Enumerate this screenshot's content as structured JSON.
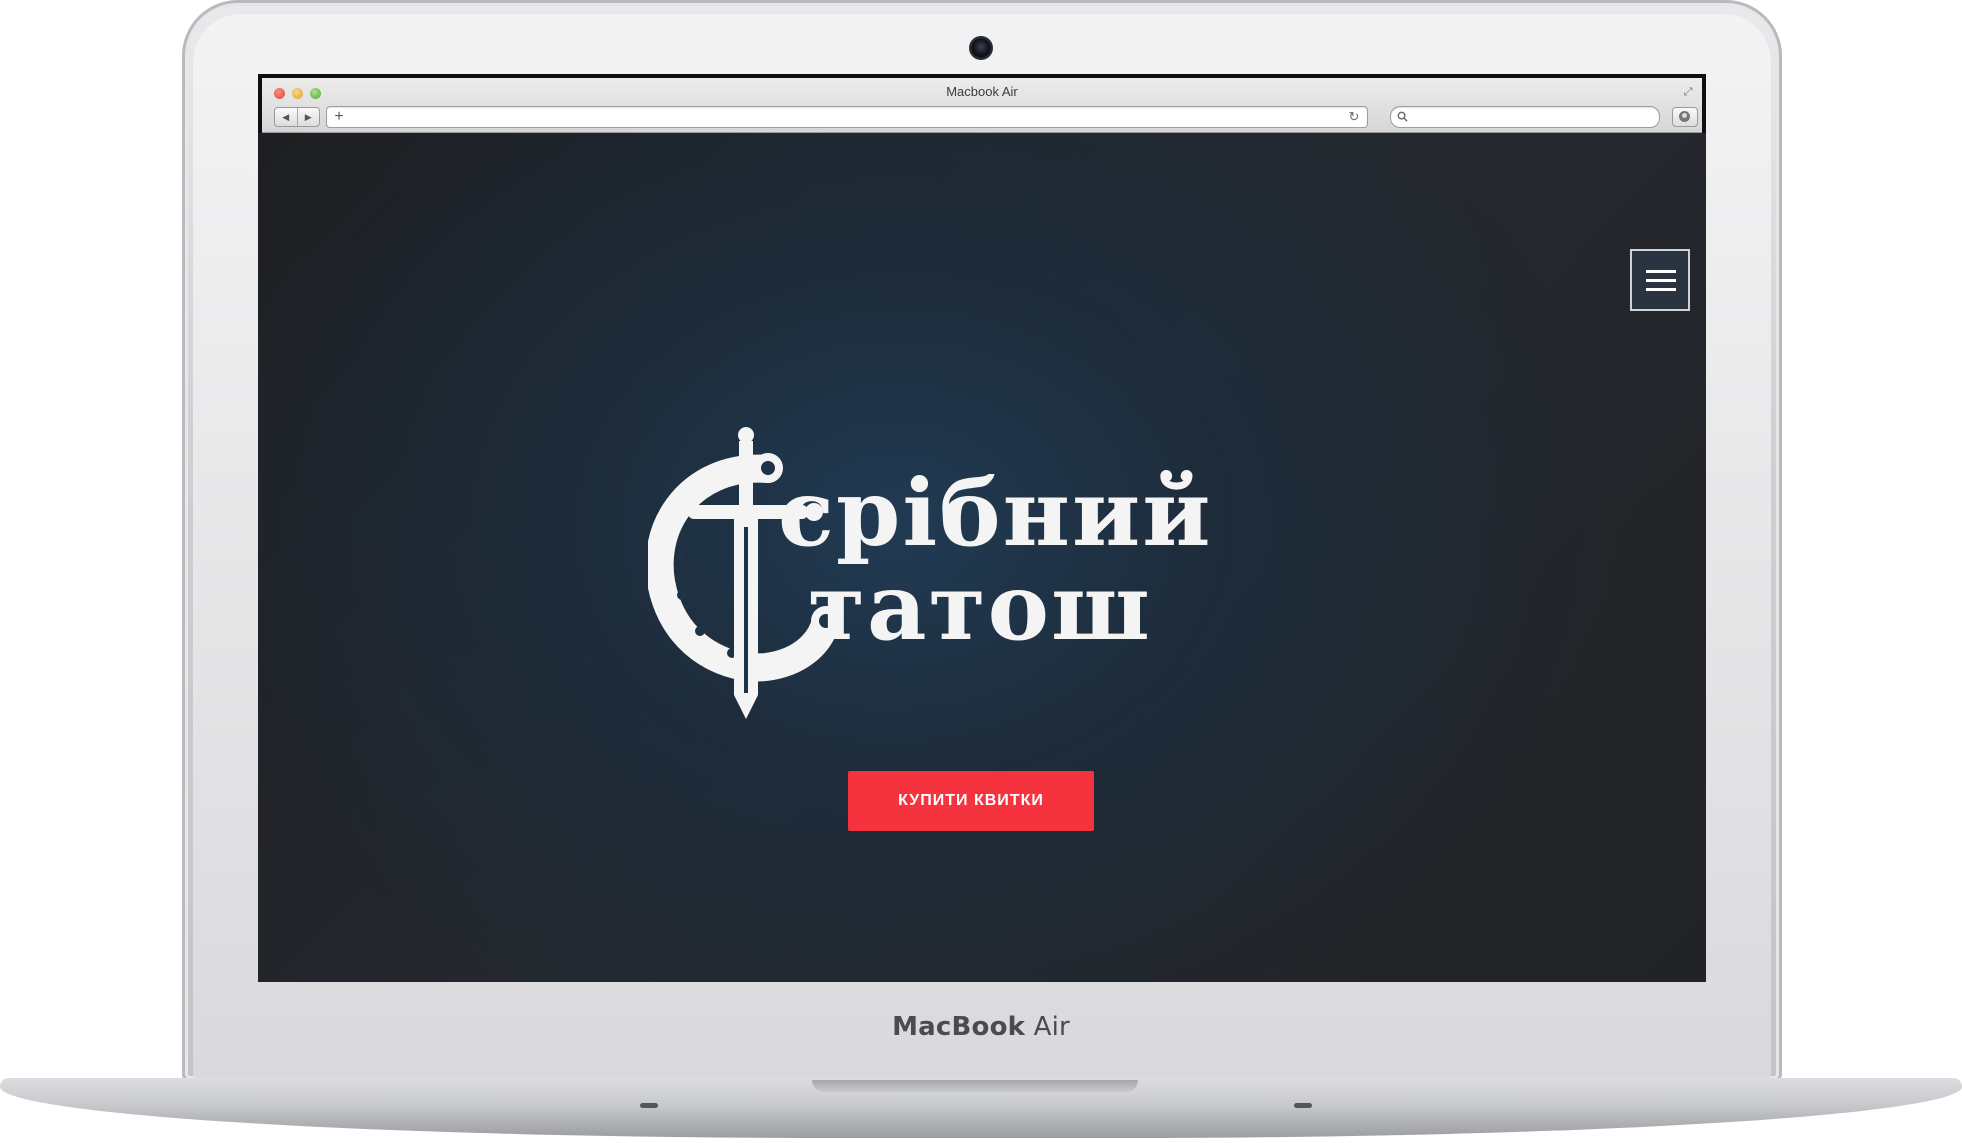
{
  "device": {
    "brand_bold": "MacBook",
    "brand_light": "Air"
  },
  "browser": {
    "window_title": "Macbook Air",
    "back_glyph": "◀",
    "forward_glyph": "▶",
    "new_tab_glyph": "+",
    "reload_glyph": "↻",
    "address_value": "",
    "search_value": ""
  },
  "site": {
    "logo_line1": "срібний",
    "logo_line2": "татош",
    "cta_label": "КУПИТИ КВИТКИ"
  },
  "colors": {
    "cta": "#f5333f",
    "page_background": "#1e232a",
    "logo": "#f4f4f4"
  },
  "icons": [
    "close-icon",
    "minimize-icon",
    "maximize-icon",
    "fullscreen-icon",
    "back-icon",
    "forward-icon",
    "plus-icon",
    "reload-icon",
    "search-icon",
    "download-icon",
    "hamburger-menu-icon",
    "sword-horseshoe-logo-icon"
  ]
}
